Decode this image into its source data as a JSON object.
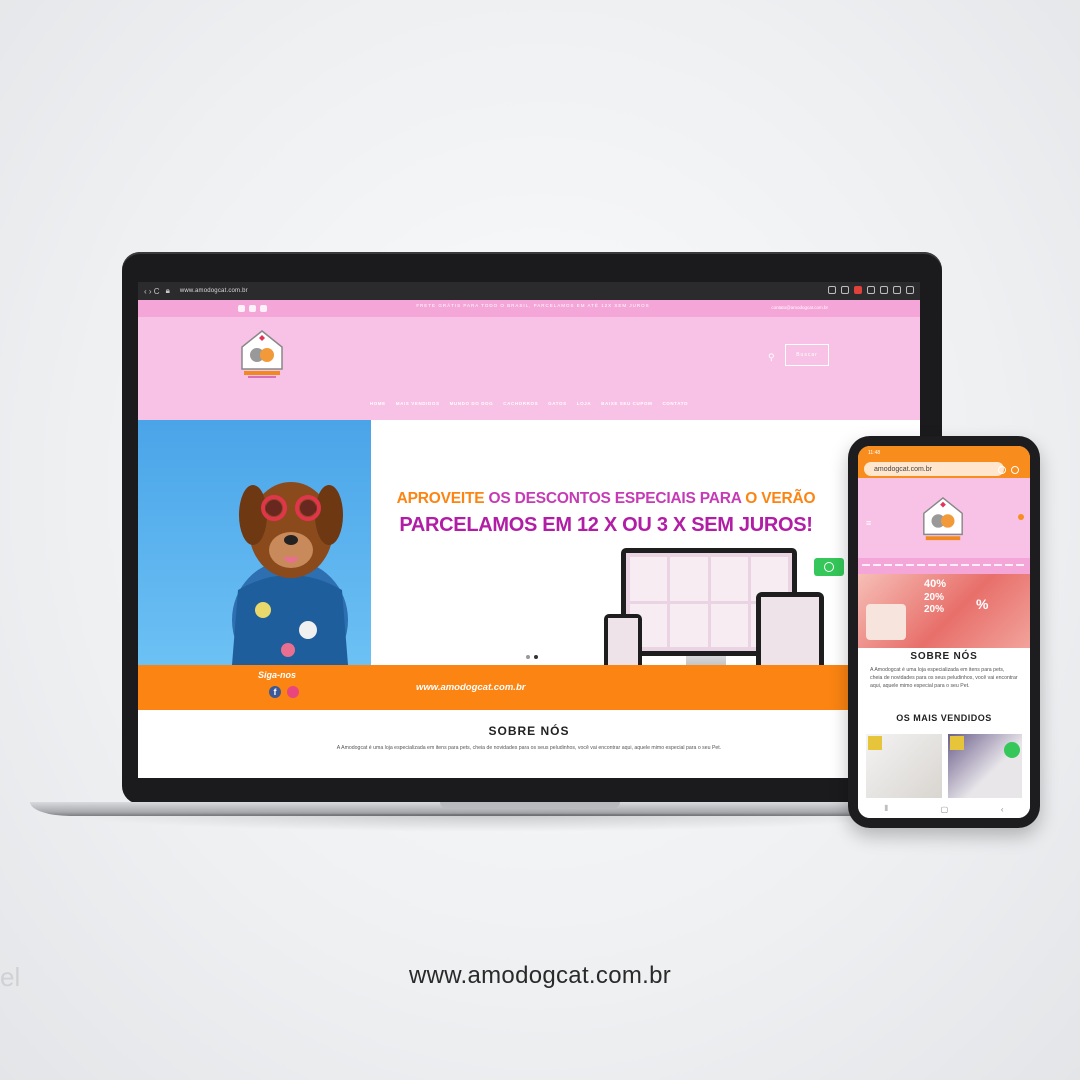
{
  "browser": {
    "url": "www.amodogcat.com.br",
    "nav_glyphs": "‹  ›  C"
  },
  "site": {
    "topbar_promo": "FRETE GRÁTIS PARA TODO O BRASIL, PARCELAMOS EM ATÉ 12X SEM JUROS",
    "topbar_email": "contato@amodogcat.com.br",
    "search_button": "Buscar",
    "menu": [
      "HOME",
      "MAIS VENDIDOS",
      "MUNDO DO DOG",
      "CACHORROS",
      "GATOS",
      "LOJA",
      "BAIXE SEU CUPOM",
      "CONTATO"
    ],
    "hero": {
      "line1_a": "APROVEITE",
      "line1_b": "OS DESCONTOS ESPECIAIS PARA",
      "line1_c": "O VERÃO",
      "line2": "PARCELAMOS EM 12 X OU 3 X SEM JUROS!",
      "follow_label": "Siga-nos",
      "site_url": "www.amodogcat.com.br"
    },
    "about": {
      "title": "SOBRE NÓS",
      "text": "A Amodogcat é uma loja especializada em itens para pets, cheia de novidades para os seus peludinhos, você vai encontrar aqui, aquele mimo especial para o seu Pet."
    }
  },
  "phone": {
    "status_time": "11:48",
    "url": "amodogcat.com.br",
    "about_title": "SOBRE NÓS",
    "about_text": "A Amodogcat é uma loja especializada em itens para pets, cheia de novidades para os seus peludinhos, você vai encontrar aqui, aquele mimo especial para o seu Pet.",
    "best_sellers_title": "OS MAIS VENDIDOS",
    "banner_pcts": [
      "40%",
      "20%",
      "20%",
      "%"
    ]
  },
  "caption": "www.amodogcat.com.br",
  "corner_mark": "el",
  "colors": {
    "pink_header": "#f8c2e6",
    "pink_bar": "#f5a6d8",
    "orange": "#fb8412",
    "magenta": "#b21da6",
    "sky": "#4aa4e8",
    "whatsapp": "#35c759"
  },
  "icons": [
    "facebook-icon",
    "instagram-icon",
    "youtube-icon",
    "search-icon",
    "whatsapp-icon",
    "menu-icon",
    "cart-icon"
  ]
}
